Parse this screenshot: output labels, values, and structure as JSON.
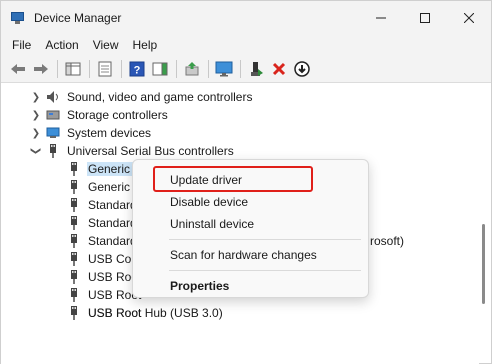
{
  "window": {
    "title": "Device Manager"
  },
  "menubar": {
    "items": [
      "File",
      "Action",
      "View",
      "Help"
    ]
  },
  "toolbar": {
    "buttons": [
      "back-arrow",
      "forward-arrow",
      "properties-sheet",
      "show-hidden",
      "help",
      "action-pane",
      "update-driver",
      "scan-hardware",
      "enable-device",
      "uninstall-device",
      "disable-device"
    ]
  },
  "tree": {
    "categories": [
      {
        "label": "Sound, video and game controllers",
        "expanded": false
      },
      {
        "label": "Storage controllers",
        "expanded": false
      },
      {
        "label": "System devices",
        "expanded": false
      },
      {
        "label": "Universal Serial Bus controllers",
        "expanded": true
      }
    ],
    "usb_children": [
      "Generic USB Hub",
      "Generic U",
      "Standard",
      "Standard",
      "Standard",
      "USB Con",
      "USB Root",
      "USB Root",
      "USB Root",
      "USB Root Hub (USB 3.0)"
    ],
    "visible_suffix": "rosoft)"
  },
  "context_menu": {
    "update_driver": "Update driver",
    "disable_device": "Disable device",
    "uninstall_device": "Uninstall device",
    "scan_hardware": "Scan for hardware changes",
    "properties": "Properties"
  },
  "colors": {
    "highlight_border": "#e0201a",
    "selection": "#cce4f7"
  }
}
